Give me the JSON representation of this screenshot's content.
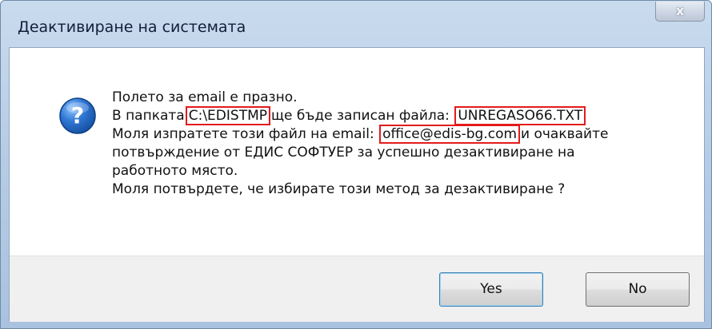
{
  "window": {
    "title": "Деактивиране на системата",
    "close_label": "x"
  },
  "icon": "question-icon",
  "message": {
    "line1": "Полето за email е празно.",
    "line2_prefix": "В папката",
    "folder": "C:\\EDISTMP",
    "line2_middle": "ще бъде записан файла:",
    "filename": "UNREGASO66.TXT",
    "line3_prefix": "Моля изпратете този файл на email:",
    "email": "office@edis-bg.com",
    "line3_suffix": "и очаквайте",
    "line4": "потвърждение от ЕДИС СОФТУЕР за успешно дезактивиране на",
    "line5": "работното място.",
    "line6": "Моля потвърдете, че избирате този метод за дезактивиране ?"
  },
  "buttons": {
    "yes": "Yes",
    "no": "No"
  },
  "colors": {
    "highlight_border": "#e31b1b",
    "icon_blue": "#1f5fb8"
  }
}
